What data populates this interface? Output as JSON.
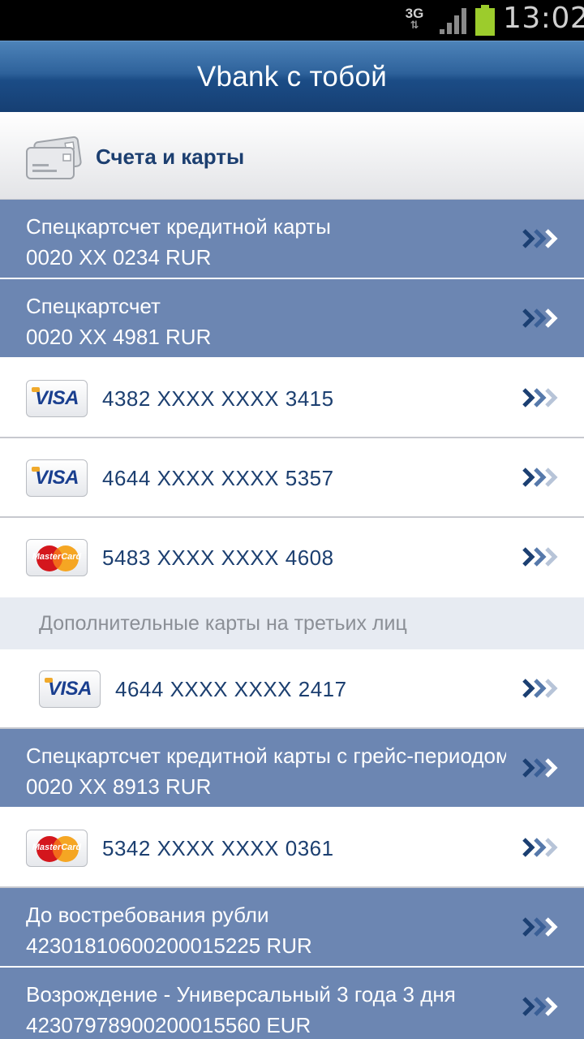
{
  "status_bar": {
    "network": "3G",
    "time": "13:02"
  },
  "header": {
    "title": "Vbank с тобой"
  },
  "section": {
    "label": "Счета и карты",
    "icon": "cards-icon"
  },
  "accounts_top": [
    {
      "name": "Спецкартсчет кредитной карты",
      "number": "0020 XX 0234 RUR"
    },
    {
      "name": "Спецкартсчет",
      "number": "0020 XX 4981 RUR"
    }
  ],
  "cards_top": [
    {
      "brand": "VISA",
      "number": "4382 XXXX XXXX 3415"
    },
    {
      "brand": "VISA",
      "number": "4644 XXXX XXXX 5357"
    },
    {
      "brand": "MasterCard",
      "number": "5483 XXXX XXXX 4608"
    }
  ],
  "third_party": {
    "label": "Дополнительные карты на третьих лиц",
    "cards": [
      {
        "brand": "VISA",
        "number": "4644 XXXX XXXX 2417"
      }
    ]
  },
  "accounts_mid": [
    {
      "name": "Спецкартсчет кредитной карты с грейс-периодом",
      "number": "0020 XX 8913 RUR"
    }
  ],
  "cards_mid": [
    {
      "brand": "MasterCard",
      "number": "5342 XXXX XXXX 0361"
    }
  ],
  "accounts_bottom": [
    {
      "name": "До востребования рубли",
      "number": "42301810600200015225 RUR"
    },
    {
      "name": "Возрождение - Универсальный 3 года 3 дня",
      "number": "42307978900200015560 EUR"
    }
  ],
  "colors": {
    "header": "#1b4c86",
    "account_row": "#6c86b2",
    "card_text": "#1c3f70",
    "subheader_bg": "#e7ebf2"
  }
}
